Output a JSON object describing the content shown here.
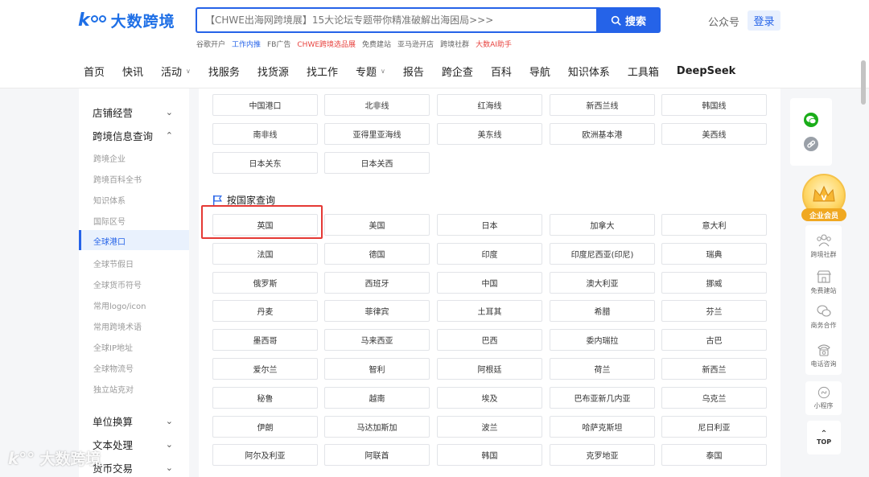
{
  "header": {
    "logo_text": "大数跨境",
    "search_placeholder": "【CHWE出海网跨境展】15大论坛专题带你精准破解出海困局>>>",
    "search_button": "搜索",
    "hot_links": [
      {
        "label": "谷歌开户",
        "style": "normal"
      },
      {
        "label": "工作内推",
        "style": "blue"
      },
      {
        "label": "FB广告",
        "style": "normal"
      },
      {
        "label": "CHWE跨境选品展",
        "style": "red"
      },
      {
        "label": "免费建站",
        "style": "normal"
      },
      {
        "label": "亚马逊开店",
        "style": "normal"
      },
      {
        "label": "跨境社群",
        "style": "normal"
      },
      {
        "label": "大数AI助手",
        "style": "red"
      }
    ],
    "gongzhonghao": "公众号",
    "login": "登录",
    "nav": [
      {
        "label": "首页",
        "dropdown": false
      },
      {
        "label": "快讯",
        "dropdown": false
      },
      {
        "label": "活动",
        "dropdown": true
      },
      {
        "label": "找服务",
        "dropdown": false
      },
      {
        "label": "找货源",
        "dropdown": false
      },
      {
        "label": "找工作",
        "dropdown": false
      },
      {
        "label": "专题",
        "dropdown": true
      },
      {
        "label": "报告",
        "dropdown": false
      },
      {
        "label": "跨企查",
        "dropdown": false
      },
      {
        "label": "百科",
        "dropdown": false
      },
      {
        "label": "导航",
        "dropdown": false
      },
      {
        "label": "知识体系",
        "dropdown": false
      },
      {
        "label": "工具箱",
        "dropdown": false
      },
      {
        "label": "DeepSeek",
        "dropdown": false
      }
    ]
  },
  "sidebar": {
    "groups": [
      {
        "label": "店铺经营",
        "expanded": false
      },
      {
        "label": "跨境信息查询",
        "expanded": true
      },
      {
        "label": "单位换算",
        "expanded": false
      },
      {
        "label": "文本处理",
        "expanded": false
      },
      {
        "label": "货币交易",
        "expanded": false
      }
    ],
    "sub_items": [
      "跨境企业",
      "跨境百科全书",
      "知识体系",
      "国际区号",
      "全球港口",
      "全球节假日",
      "全球货币符号",
      "常用logo/icon",
      "常用跨境术语",
      "全球IP地址",
      "全球物流号",
      "独立站克对"
    ],
    "active_item": "全球港口"
  },
  "main": {
    "routes": [
      "中国港口",
      "北非线",
      "红海线",
      "新西兰线",
      "韩国线",
      "南非线",
      "亚得里亚海线",
      "美东线",
      "欧洲基本港",
      "美西线",
      "日本关东",
      "日本关西"
    ],
    "country_section_title": "按国家查询",
    "countries": [
      "英国",
      "美国",
      "日本",
      "加拿大",
      "意大利",
      "法国",
      "德国",
      "印度",
      "印度尼西亚(印尼)",
      "瑞典",
      "俄罗斯",
      "西班牙",
      "中国",
      "澳大利亚",
      "挪威",
      "丹麦",
      "菲律宾",
      "土耳其",
      "希腊",
      "芬兰",
      "墨西哥",
      "马来西亚",
      "巴西",
      "委内瑞拉",
      "古巴",
      "爱尔兰",
      "智利",
      "阿根廷",
      "荷兰",
      "新西兰",
      "秘鲁",
      "越南",
      "埃及",
      "巴布亚新几内亚",
      "乌克兰",
      "伊朗",
      "马达加斯加",
      "波兰",
      "哈萨克斯坦",
      "尼日利亚",
      "阿尔及利亚",
      "阿联酋",
      "韩国",
      "克罗地亚",
      "泰国"
    ],
    "highlighted": "英国"
  },
  "right_toolbar": {
    "vip_label": "企业会员",
    "items": [
      "跨境社群",
      "免费建站",
      "商务合作",
      "电话咨询"
    ],
    "mini_program": "小程序",
    "top": "TOP"
  },
  "watermark": "大数跨境",
  "colors": {
    "brand": "#2563e8",
    "highlight_border": "#e53935",
    "red_link": "#e8433f",
    "vip_gold": "#f0a821"
  }
}
